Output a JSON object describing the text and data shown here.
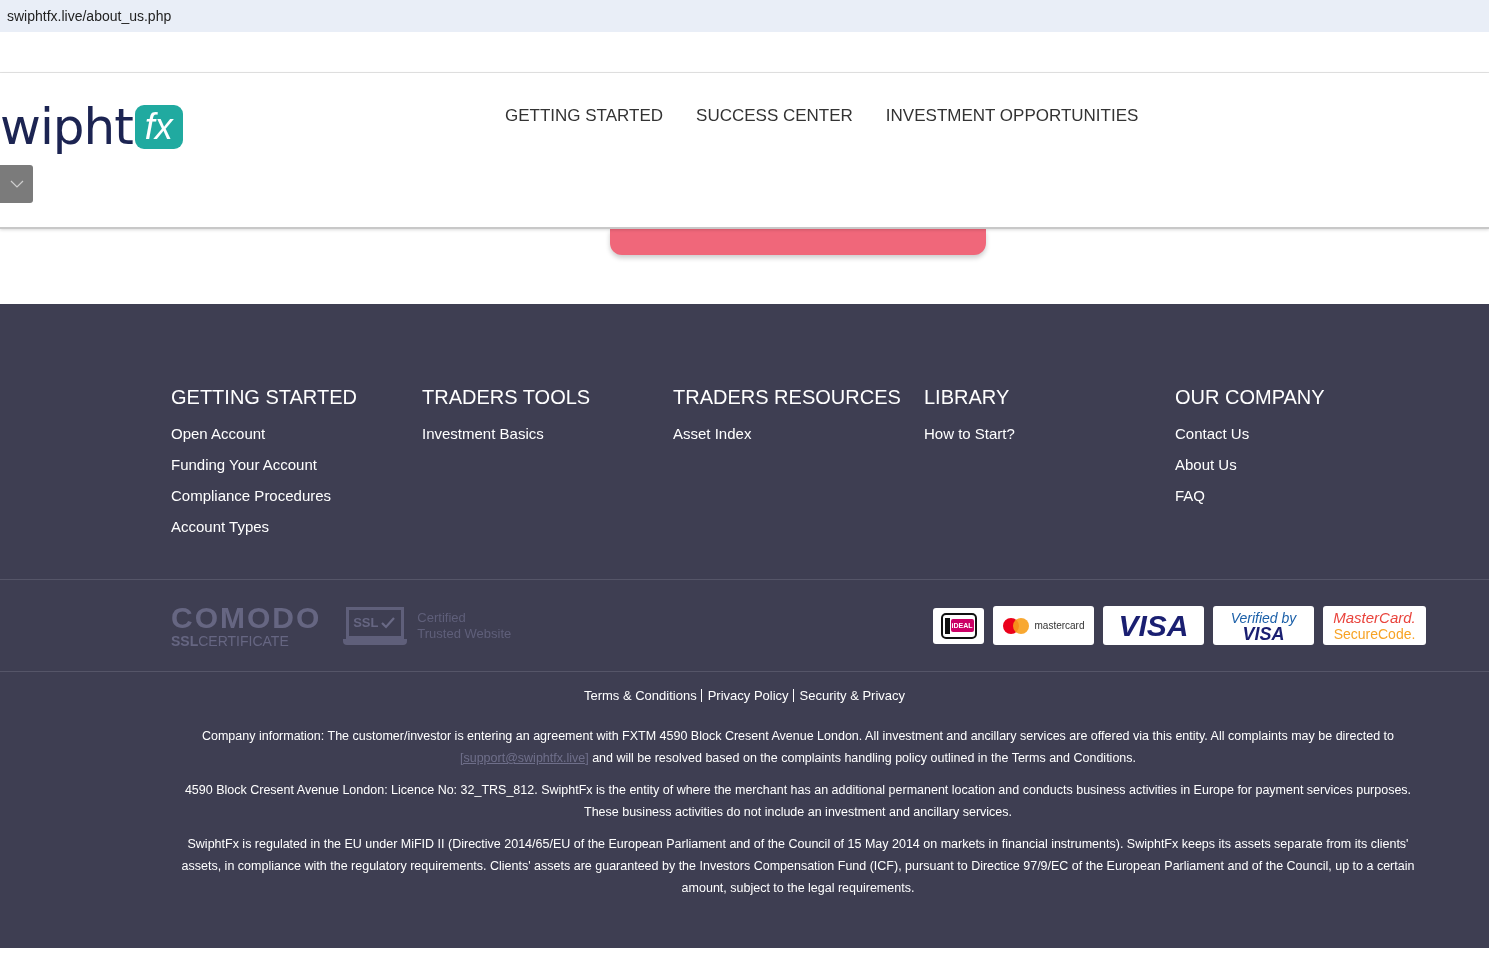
{
  "address_bar": {
    "url": "swiphtfx.live/about_us.php"
  },
  "header": {
    "logo": {
      "word": "wipht",
      "badge": "fx"
    },
    "nav": [
      {
        "label": "GETTING STARTED"
      },
      {
        "label": "SUCCESS CENTER"
      },
      {
        "label": "INVESTMENT OPPORTUNITIES"
      }
    ]
  },
  "footer": {
    "columns": [
      {
        "heading": "GETTING STARTED",
        "links": [
          "Open Account",
          "Funding Your Account",
          "Compliance Procedures",
          "Account Types"
        ]
      },
      {
        "heading": "TRADERS TOOLS",
        "links": [
          "Investment Basics"
        ]
      },
      {
        "heading": "TRADERS RESOURCES",
        "links": [
          "Asset Index"
        ]
      },
      {
        "heading": "LIBRARY",
        "links": [
          "How to Start?"
        ]
      },
      {
        "heading": "OUR COMPANY",
        "links": [
          "Contact Us",
          "About Us",
          "FAQ"
        ]
      }
    ],
    "security": {
      "comodo": {
        "name": "COMODO",
        "ssl": "SSL",
        "certificate": "CERTIFICATE"
      },
      "ssl_badge": {
        "mark": "SSL",
        "line_1": "Certified",
        "line_2": "Trusted Website"
      }
    },
    "payments": [
      {
        "kind": "ideal",
        "texts": [
          "iDEAL"
        ]
      },
      {
        "kind": "mastercard",
        "texts": [
          "mastercard"
        ]
      },
      {
        "kind": "visa",
        "texts": [
          "VISA"
        ]
      },
      {
        "kind": "verified",
        "texts": [
          "Verified by",
          "VISA"
        ]
      },
      {
        "kind": "securecode",
        "texts": [
          "MasterCard.",
          "SecureCode."
        ]
      }
    ],
    "legal_links": [
      "Terms & Conditions",
      "Privacy Policy",
      "Security & Privacy"
    ],
    "paragraphs": [
      {
        "before": "Company information: The customer/investor is entering an agreement with FXTM 4590 Block Cresent Avenue London. All investment and ancillary services are offered via this entity. All complaints may be directed to ",
        "link": "[support@swiphtfx.live]",
        "after": " and will be resolved based on the complaints handling policy outlined in the Terms and Conditions."
      },
      {
        "before": "4590 Block Cresent Avenue London: Licence No: 32_TRS_812. SwiphtFx is the entity of where the merchant has an additional permanent location and conducts business activities in Europe for payment services purposes. These business activities do not include an investment and ancillary services."
      },
      {
        "before": "SwiphtFx is regulated in the EU under MiFID II (Directive 2014/65/EU of the European Parliament and of the Council of 15 May 2014 on markets in financial instruments). SwiphtFx keeps its assets separate from its clients' assets, in compliance with the regulatory requirements. Clients' assets are guaranteed by the Investors Compensation Fund (ICF), pursuant to Directice 97/9/EC of the European Parliament and of the Council, up to a certain amount, subject to the legal requirements."
      }
    ]
  }
}
